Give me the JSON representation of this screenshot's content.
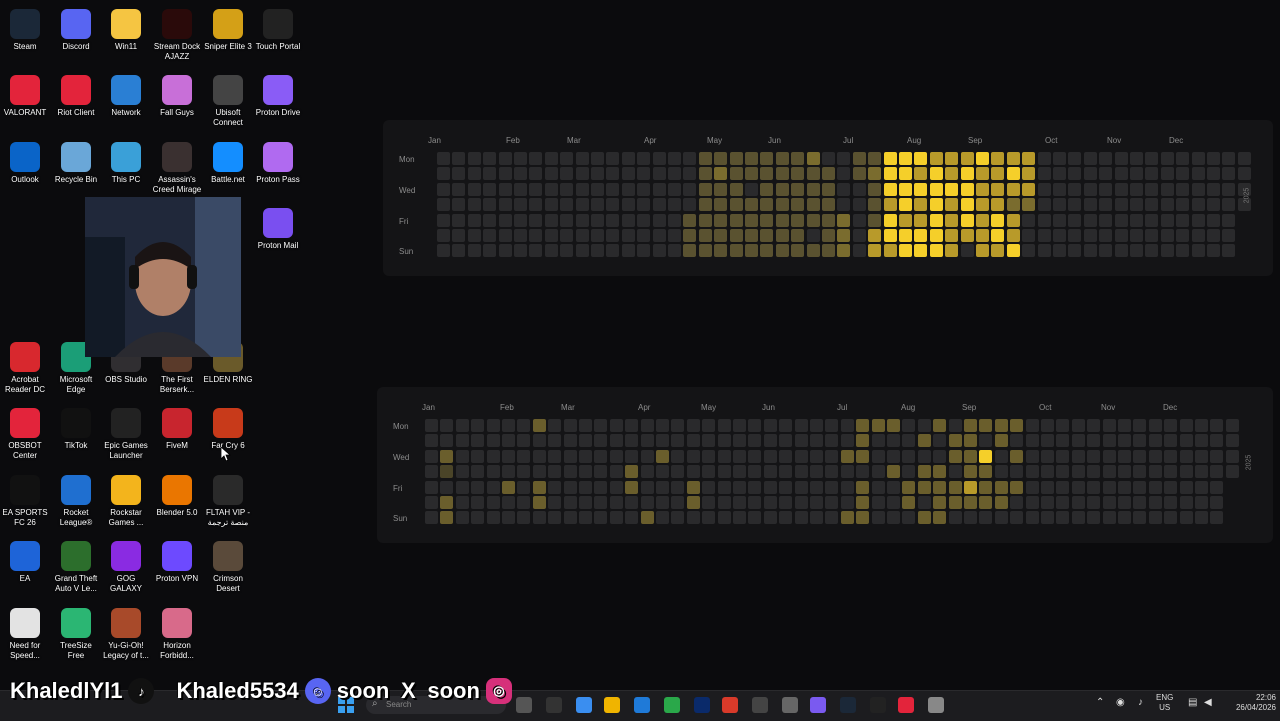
{
  "desktop": {
    "icons": [
      {
        "label": "Steam",
        "color": "#1b2838"
      },
      {
        "label": "Discord",
        "color": "#5865f2"
      },
      {
        "label": "Win11",
        "color": "#f5c542"
      },
      {
        "label": "Stream Dock AJAZZ",
        "color": "#2a0a0a"
      },
      {
        "label": "Sniper Elite 3",
        "color": "#d4a017"
      },
      {
        "label": "Touch Portal",
        "color": "#222"
      },
      {
        "label": "VALORANT",
        "color": "#e3243b"
      },
      {
        "label": "Riot Client",
        "color": "#e3243b"
      },
      {
        "label": "Network",
        "color": "#2a7fd4"
      },
      {
        "label": "Fall Guys",
        "color": "#c86fd8"
      },
      {
        "label": "Ubisoft Connect",
        "color": "#444"
      },
      {
        "label": "Proton Drive",
        "color": "#8a5cf6"
      },
      {
        "label": "Outlook",
        "color": "#0a64c8"
      },
      {
        "label": "Recycle Bin",
        "color": "#6aa7d8"
      },
      {
        "label": "This PC",
        "color": "#3aa0d8"
      },
      {
        "label": "Assassin's Creed Mirage",
        "color": "#3a3030"
      },
      {
        "label": "Battle.net",
        "color": "#148eff"
      },
      {
        "label": "Proton Pass",
        "color": "#b06af0"
      },
      {
        "label": "Proton Mail",
        "color": "#7a4ff0"
      },
      {
        "label": "Acrobat Reader DC",
        "color": "#d8282e"
      },
      {
        "label": "Microsoft Edge",
        "color": "#1b9e77"
      },
      {
        "label": "OBS Studio",
        "color": "#302e31"
      },
      {
        "label": "The First Berserk...",
        "color": "#5a3a2a"
      },
      {
        "label": "ELDEN RING",
        "color": "#6a5a2a"
      },
      {
        "label": "OBSBOT Center",
        "color": "#e3243b"
      },
      {
        "label": "TikTok",
        "color": "#111"
      },
      {
        "label": "Epic Games Launcher",
        "color": "#222"
      },
      {
        "label": "FiveM",
        "color": "#c8252e"
      },
      {
        "label": "Far Cry 6",
        "color": "#c83a1a"
      },
      {
        "label": "EA SPORTS FC 26",
        "color": "#111"
      },
      {
        "label": "Rocket League®",
        "color": "#1f6fd0"
      },
      {
        "label": "Rockstar Games ...",
        "color": "#f3b41c"
      },
      {
        "label": "Blender 5.0",
        "color": "#ea7600"
      },
      {
        "label": "FLTAH VIP - منصة ترجمة",
        "color": "#2a2a2a"
      },
      {
        "label": "EA",
        "color": "#1e64d8"
      },
      {
        "label": "Grand Theft Auto V Le...",
        "color": "#2c6e2c"
      },
      {
        "label": "GOG GALAXY",
        "color": "#8a2be2"
      },
      {
        "label": "Proton VPN",
        "color": "#6d4aff"
      },
      {
        "label": "Crimson Desert",
        "color": "#5a4a3a"
      },
      {
        "label": "Need for Speed...",
        "color": "#e3e3e3"
      },
      {
        "label": "TreeSize Free",
        "color": "#2bb673"
      },
      {
        "label": "Yu-Gi-Oh! Legacy of t...",
        "color": "#a84a2a"
      },
      {
        "label": "Horizon Forbidd...",
        "color": "#d86a8a"
      }
    ]
  },
  "heatmaps": [
    {
      "year_label": "2025",
      "months": [
        "Jan",
        "Feb",
        "Mar",
        "Apr",
        "May",
        "Jun",
        "Jul",
        "Aug",
        "Sep",
        "Oct",
        "Nov",
        "Dec"
      ],
      "days": [
        "Mon",
        "Wed",
        "Fri",
        "Sun"
      ],
      "levels": [
        "#2a2a2c",
        "#5a5230",
        "#7a6c2e",
        "#b89a2a",
        "#f5cf2a"
      ],
      "weeks": 53,
      "active_cols": [
        {
          "c": 16,
          "rows": [
            0,
            0,
            0,
            0,
            1,
            1,
            1
          ]
        },
        {
          "c": 17,
          "rows": [
            1,
            1,
            1,
            1,
            1,
            1,
            1
          ]
        },
        {
          "c": 18,
          "rows": [
            1,
            2,
            1,
            1,
            1,
            1,
            1
          ]
        },
        {
          "c": 19,
          "rows": [
            1,
            1,
            1,
            1,
            1,
            1,
            1
          ]
        },
        {
          "c": 20,
          "rows": [
            1,
            1,
            0,
            1,
            1,
            1,
            1
          ]
        },
        {
          "c": 21,
          "rows": [
            1,
            1,
            1,
            1,
            1,
            1,
            1
          ]
        },
        {
          "c": 22,
          "rows": [
            1,
            1,
            1,
            1,
            1,
            1,
            1
          ]
        },
        {
          "c": 23,
          "rows": [
            1,
            1,
            1,
            1,
            1,
            1,
            1
          ]
        },
        {
          "c": 24,
          "rows": [
            2,
            1,
            1,
            1,
            1,
            0,
            1
          ]
        },
        {
          "c": 25,
          "rows": [
            0,
            1,
            1,
            1,
            1,
            1,
            1
          ]
        },
        {
          "c": 26,
          "rows": [
            0,
            0,
            0,
            0,
            2,
            2,
            2
          ]
        },
        {
          "c": 27,
          "rows": [
            1,
            1,
            0,
            0,
            0,
            0,
            0
          ]
        },
        {
          "c": 28,
          "rows": [
            1,
            2,
            1,
            1,
            1,
            3,
            3
          ]
        },
        {
          "c": 29,
          "rows": [
            4,
            4,
            4,
            3,
            4,
            4,
            3
          ]
        },
        {
          "c": 30,
          "rows": [
            4,
            4,
            4,
            4,
            3,
            4,
            4
          ]
        },
        {
          "c": 31,
          "rows": [
            4,
            3,
            4,
            3,
            3,
            4,
            4
          ]
        },
        {
          "c": 32,
          "rows": [
            3,
            4,
            4,
            4,
            4,
            4,
            4
          ]
        },
        {
          "c": 33,
          "rows": [
            3,
            3,
            4,
            3,
            3,
            3,
            3
          ]
        },
        {
          "c": 34,
          "rows": [
            3,
            4,
            4,
            4,
            4,
            3,
            0
          ]
        },
        {
          "c": 35,
          "rows": [
            4,
            3,
            3,
            3,
            3,
            3,
            3
          ]
        },
        {
          "c": 36,
          "rows": [
            3,
            3,
            3,
            3,
            4,
            4,
            3
          ]
        },
        {
          "c": 37,
          "rows": [
            3,
            4,
            3,
            2,
            3,
            3,
            4
          ]
        },
        {
          "c": 38,
          "rows": [
            3,
            3,
            3,
            2,
            0,
            0,
            0
          ]
        }
      ]
    },
    {
      "year_label": "2025",
      "months": [
        "Jan",
        "Feb",
        "Mar",
        "Apr",
        "May",
        "Jun",
        "Jul",
        "Aug",
        "Sep",
        "Oct",
        "Nov",
        "Dec"
      ],
      "days": [
        "Mon",
        "Wed",
        "Fri",
        "Sun"
      ],
      "levels": [
        "#2a2a2c",
        "#4a4428",
        "#6a5e2c",
        "#b89a2a",
        "#f5cf2a"
      ],
      "weeks": 53,
      "active_cols": [
        {
          "c": 1,
          "rows": [
            0,
            0,
            2,
            1,
            0,
            2,
            2
          ]
        },
        {
          "c": 7,
          "rows": [
            2,
            0,
            0,
            0,
            0,
            0,
            0
          ]
        },
        {
          "c": 5,
          "rows": [
            0,
            0,
            0,
            0,
            2,
            0,
            0
          ]
        },
        {
          "c": 7,
          "rows": [
            0,
            0,
            0,
            0,
            2,
            2,
            0
          ]
        },
        {
          "c": 13,
          "rows": [
            0,
            0,
            0,
            2,
            2,
            0,
            0
          ]
        },
        {
          "c": 14,
          "rows": [
            0,
            0,
            0,
            0,
            0,
            0,
            2
          ]
        },
        {
          "c": 15,
          "rows": [
            0,
            0,
            2,
            0,
            0,
            0,
            0
          ]
        },
        {
          "c": 17,
          "rows": [
            0,
            0,
            0,
            0,
            2,
            2,
            0
          ]
        },
        {
          "c": 27,
          "rows": [
            0,
            0,
            2,
            0,
            0,
            0,
            2
          ]
        },
        {
          "c": 28,
          "rows": [
            2,
            2,
            2,
            0,
            2,
            2,
            2
          ]
        },
        {
          "c": 29,
          "rows": [
            2,
            0,
            0,
            0,
            0,
            0,
            0
          ]
        },
        {
          "c": 30,
          "rows": [
            2,
            0,
            0,
            2,
            0,
            0,
            0
          ]
        },
        {
          "c": 31,
          "rows": [
            0,
            0,
            0,
            0,
            2,
            2,
            0
          ]
        },
        {
          "c": 32,
          "rows": [
            0,
            2,
            0,
            2,
            2,
            0,
            2
          ]
        },
        {
          "c": 33,
          "rows": [
            2,
            0,
            0,
            2,
            2,
            2,
            2
          ]
        },
        {
          "c": 34,
          "rows": [
            0,
            2,
            2,
            0,
            2,
            2,
            0
          ]
        },
        {
          "c": 35,
          "rows": [
            2,
            2,
            2,
            2,
            3,
            2,
            0
          ]
        },
        {
          "c": 36,
          "rows": [
            2,
            0,
            4,
            2,
            2,
            2,
            0
          ]
        },
        {
          "c": 37,
          "rows": [
            2,
            2,
            0,
            0,
            2,
            2,
            0
          ]
        },
        {
          "c": 38,
          "rows": [
            2,
            0,
            2,
            0,
            2,
            0,
            0
          ]
        }
      ]
    }
  ],
  "social": {
    "handle1": "KhaledlYl1",
    "handle2": "Khaled5534",
    "soon1": "soon",
    "soon2": "soon"
  },
  "taskbar": {
    "search_placeholder": "Search",
    "lang": "ENG",
    "region": "US",
    "time": "22:06",
    "date": "26/04/2026"
  }
}
